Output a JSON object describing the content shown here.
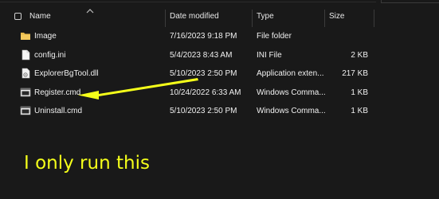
{
  "header": {
    "columns": [
      {
        "label": "Name"
      },
      {
        "label": "Date modified"
      },
      {
        "label": "Type"
      },
      {
        "label": "Size"
      }
    ]
  },
  "files": [
    {
      "name": "Image",
      "date": "7/16/2023 9:18 PM",
      "type": "File folder",
      "size": "",
      "icon": "folder-icon"
    },
    {
      "name": "config.ini",
      "date": "5/4/2023 8:43 AM",
      "type": "INI File",
      "size": "2 KB",
      "icon": "ini-file-icon"
    },
    {
      "name": "ExplorerBgTool.dll",
      "date": "5/10/2023 2:50 PM",
      "type": "Application exten...",
      "size": "217 KB",
      "icon": "dll-file-icon"
    },
    {
      "name": "Register.cmd",
      "date": "10/24/2022 6:33 AM",
      "type": "Windows Comma...",
      "size": "1 KB",
      "icon": "cmd-file-icon"
    },
    {
      "name": "Uninstall.cmd",
      "date": "5/10/2023 2:50 PM",
      "type": "Windows Comma...",
      "size": "1 KB",
      "icon": "cmd-file-icon"
    }
  ],
  "annotation": {
    "caption": "I only run this",
    "color": "#f5ff1a"
  },
  "colors": {
    "background": "#191919",
    "folder": "#e8b94a",
    "annotation": "#f5ff1a"
  }
}
